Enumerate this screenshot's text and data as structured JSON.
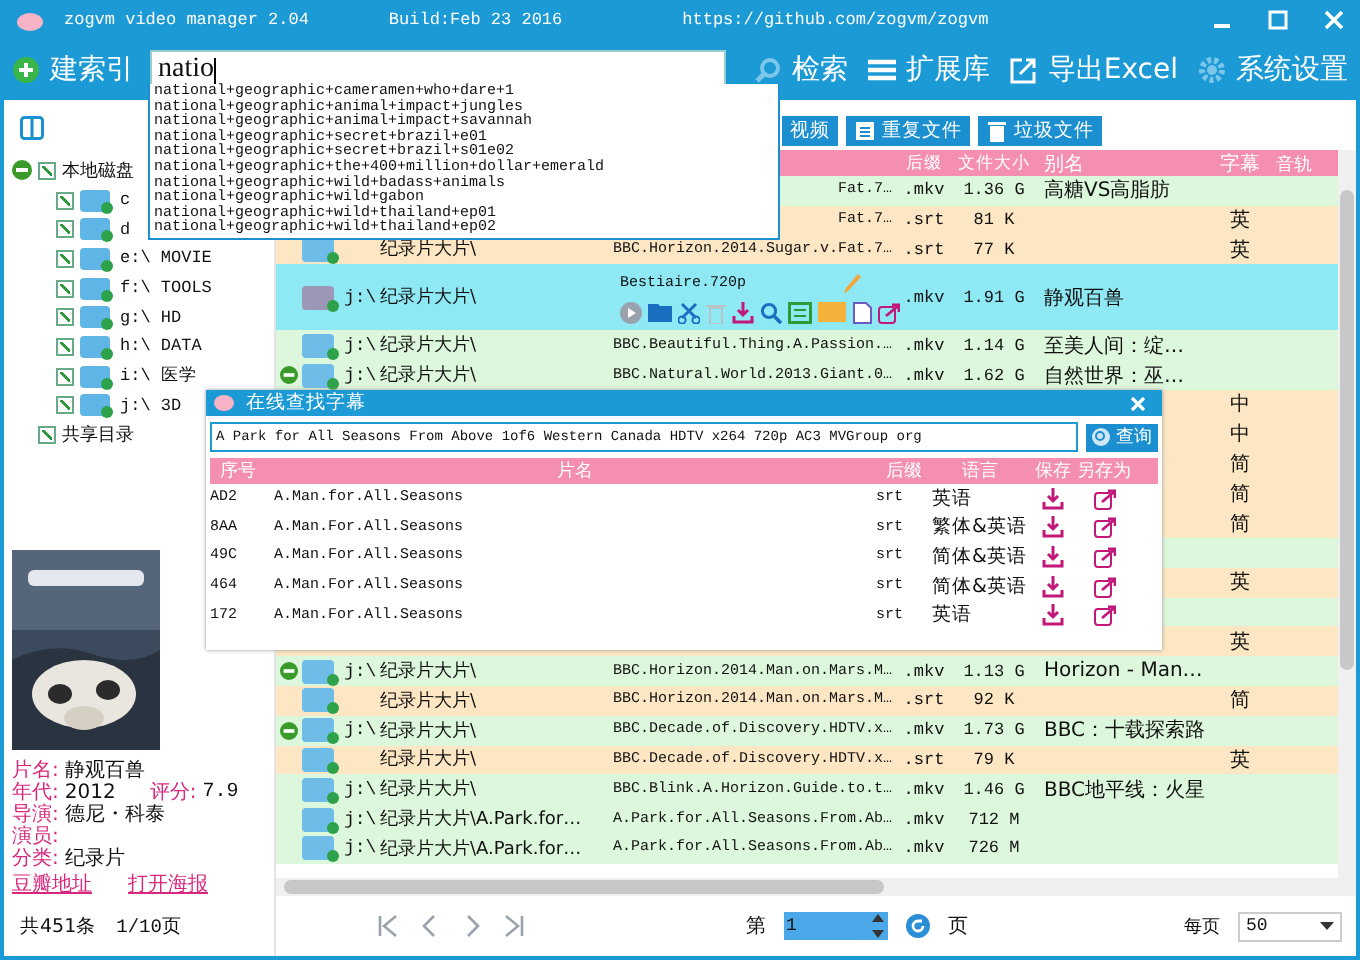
{
  "window": {
    "title": "zogvm video manager 2.04",
    "build": "Build:Feb 23 2016",
    "url": "https://github.com/zogvm/zogvm"
  },
  "toolbar": {
    "index_button": "建索引",
    "search": {
      "value": "natio"
    },
    "buttons": [
      {
        "label": "检索",
        "kind": "search"
      },
      {
        "label": "扩展库",
        "kind": "list"
      },
      {
        "label": "导出Excel",
        "kind": "export"
      },
      {
        "label": "系统设置",
        "kind": "settings"
      }
    ]
  },
  "suggestions": [
    "national+geographic+cameramen+who+dare+1",
    "national+geographic+animal+impact+jungles",
    "national+geographic+animal+impact+savannah",
    "national+geographic+secret+brazil+e01",
    "national+geographic+secret+brazil+s01e02",
    "national+geographic+the+400+million+dollar+emerald",
    "national+geographic+wild+badass+animals",
    "national+geographic+wild+gabon",
    "national+geographic+wild+thailand+ep01",
    "national+geographic+wild+thailand+ep02"
  ],
  "tree": {
    "local": {
      "label": "本地磁盘",
      "checked": true,
      "expanded": true,
      "children": [
        {
          "label": "c",
          "checked": true
        },
        {
          "label": "d",
          "checked": true
        },
        {
          "label": "e:\\ MOVIE",
          "checked": true
        },
        {
          "label": "f:\\ TOOLS",
          "checked": true
        },
        {
          "label": "g:\\ HD",
          "checked": true
        },
        {
          "label": "h:\\ DATA",
          "checked": true
        },
        {
          "label": "i:\\ 医学",
          "checked": true
        },
        {
          "label": "j:\\ 3D",
          "checked": true
        }
      ]
    },
    "shared": {
      "label": "共享目录",
      "checked": true
    }
  },
  "movie_info": {
    "poster": {
      "kind": "picture"
    },
    "fields": [
      {
        "label": "片名:",
        "value": "静观百兽"
      },
      {
        "label": "年代:",
        "value": "2012",
        "rating_label": "评分:",
        "rating": "7.9"
      },
      {
        "label": "导演:",
        "value": "德尼・科泰"
      },
      {
        "label": "演员:"
      },
      {
        "label": "分类:",
        "value": "纪录片"
      }
    ],
    "links": [
      "豆瓣地址",
      "打开海报"
    ]
  },
  "summary": {
    "count": "共451条",
    "pages": "1/10页"
  },
  "tool_buttons": [
    {
      "label": "视频",
      "kind": "video"
    },
    {
      "label": "重复文件",
      "kind": "duplicate"
    },
    {
      "label": "垃圾文件",
      "kind": "trash"
    }
  ],
  "table": {
    "columns": [
      "后缀",
      "文件大小",
      "别名",
      "字幕",
      "音轨"
    ],
    "rows": [
      {
        "kind": "video",
        "selected": false,
        "expanded": false,
        "name": "Fat.7…",
        "ext": ".mkv",
        "size": "1.36 G",
        "alias": "高糖VS高脂肪"
      },
      {
        "kind": "subtitle",
        "selected": false,
        "expanded": false,
        "name": "Fat.7…",
        "ext": ".srt",
        "size": "81 K",
        "sub": "英"
      },
      {
        "kind": "subtitle",
        "selected": false,
        "expanded": false,
        "path": "纪录片大片\\",
        "name": "BBC.Horizon.2014.Sugar.v.Fat.7…",
        "ext": ".srt",
        "size": "77 K",
        "sub": "英"
      },
      {
        "kind": "video",
        "selected": true,
        "expanded": false,
        "drive": "j:\\",
        "path": "纪录片大片\\",
        "name": "Bestiaire.720p",
        "ext": ".mkv",
        "size": "1.91 G",
        "alias": "静观百兽"
      },
      {
        "kind": "video",
        "selected": false,
        "expanded": false,
        "drive": "j:\\",
        "path": "纪录片大片\\",
        "name": "BBC.Beautiful.Thing.A.Passion.…",
        "ext": ".mkv",
        "size": "1.14 G",
        "alias": "至美人间：绽…"
      },
      {
        "kind": "video",
        "selected": false,
        "expanded": true,
        "drive": "j:\\",
        "path": "纪录片大片\\",
        "name": "BBC.Natural.World.2013.Giant.0…",
        "ext": ".mkv",
        "size": "1.62 G",
        "alias": "自然世界：巫…"
      },
      {
        "kind": "subtitle",
        "selected": false,
        "expanded": false,
        "sub": "中"
      },
      {
        "kind": "subtitle",
        "selected": false,
        "expanded": false,
        "sub": "中"
      },
      {
        "kind": "subtitle",
        "selected": false,
        "expanded": false,
        "sub": "简"
      },
      {
        "kind": "subtitle",
        "selected": false,
        "expanded": false,
        "sub": "简"
      },
      {
        "kind": "subtitle",
        "selected": false,
        "expanded": false,
        "sub": "简"
      },
      {
        "kind": "video",
        "selected": false
      },
      {
        "kind": "subtitle",
        "selected": false,
        "expanded": false,
        "sub": "英"
      },
      {
        "kind": "video",
        "selected": false
      },
      {
        "kind": "subtitle",
        "selected": false,
        "expanded": false,
        "sub": "英"
      },
      {
        "kind": "video",
        "selected": false,
        "expanded": true,
        "drive": "j:\\",
        "path": "纪录片大片\\",
        "name": "BBC.Horizon.2014.Man.on.Mars.M…",
        "ext": ".mkv",
        "size": "1.13 G",
        "alias": "Horizon - Man…"
      },
      {
        "kind": "subtitle",
        "selected": false,
        "expanded": false,
        "path": "纪录片大片\\",
        "name": "BBC.Horizon.2014.Man.on.Mars.M…",
        "ext": ".srt",
        "size": "92 K",
        "sub": "简"
      },
      {
        "kind": "video",
        "selected": false,
        "expanded": true,
        "drive": "j:\\",
        "path": "纪录片大片\\",
        "name": "BBC.Decade.of.Discovery.HDTV.x…",
        "ext": ".mkv",
        "size": "1.73 G",
        "alias": "BBC：十载探索路"
      },
      {
        "kind": "subtitle",
        "selected": false,
        "expanded": false,
        "path": "纪录片大片\\",
        "name": "BBC.Decade.of.Discovery.HDTV.x…",
        "ext": ".srt",
        "size": "79 K",
        "sub": "英"
      },
      {
        "kind": "video",
        "selected": false,
        "expanded": false,
        "drive": "j:\\",
        "path": "纪录片大片\\",
        "name": "BBC.Blink.A.Horizon.Guide.to.t…",
        "ext": ".mkv",
        "size": "1.46 G",
        "alias": "BBC地平线：火星"
      },
      {
        "kind": "video",
        "selected": false,
        "expanded": false,
        "drive": "j:\\",
        "path": "纪录片大片\\A.Park.for…",
        "name": "A.Park.for.All.Seasons.From.Ab…",
        "ext": ".mkv",
        "size": "712 M"
      },
      {
        "kind": "video",
        "selected": false,
        "expanded": false,
        "drive": "j:\\",
        "path": "纪录片大片\\A.Park.for…",
        "name": "A.Park.for.All.Seasons.From.Ab…",
        "ext": ".mkv",
        "size": "726 M"
      }
    ]
  },
  "pagination": {
    "page_label": "第",
    "page": "1",
    "page_suffix": "页",
    "per_page_label": "每页",
    "per_page": "50"
  },
  "subtitle_dialog": {
    "title": "在线查找字幕",
    "query": "A Park for All Seasons From Above 1of6 Western Canada HDTV x264 720p AC3 MVGroup org",
    "search_button": "查询",
    "columns": [
      "序号",
      "片名",
      "后缀",
      "语言",
      "保存",
      "另存为"
    ],
    "rows": [
      {
        "id": "AD2",
        "title": "A.Man.for.All.Seasons",
        "ext": "srt",
        "language": "英语"
      },
      {
        "id": "8AA",
        "title": "A.Man.For.All.Seasons",
        "ext": "srt",
        "language": "繁体&英语"
      },
      {
        "id": "49C",
        "title": "A.Man.For.All.Seasons",
        "ext": "srt",
        "language": "简体&英语"
      },
      {
        "id": "464",
        "title": "A.Man.For.All.Seasons",
        "ext": "srt",
        "language": "简体&英语"
      },
      {
        "id": "172",
        "title": "A.Man.For.All.Seasons",
        "ext": "srt",
        "language": "英语"
      }
    ]
  }
}
